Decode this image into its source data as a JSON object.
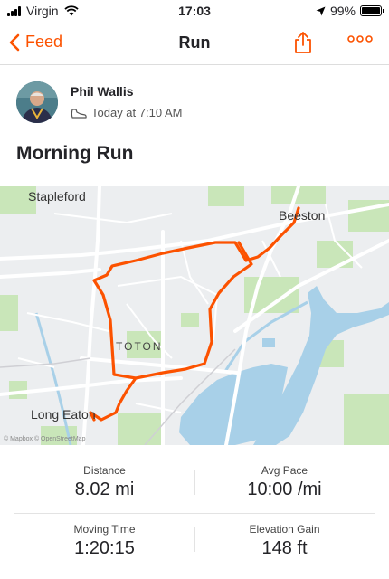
{
  "status": {
    "carrier": "Virgin",
    "time": "17:03",
    "battery": "99%",
    "battery_level": 0.99
  },
  "nav": {
    "back_label": "Feed",
    "title": "Run"
  },
  "athlete": {
    "name": "Phil Wallis",
    "timestamp": "Today at 7:10 AM"
  },
  "activity": {
    "title": "Morning Run"
  },
  "map": {
    "labels": {
      "stapleford": "Stapleford",
      "beeston": "Beeston",
      "toton": "TOTON",
      "long_eaton": "Long Eaton"
    },
    "attribution": "© Mapbox © OpenStreetMap"
  },
  "stats": {
    "distance_label": "Distance",
    "distance_value": "8.02 mi",
    "pace_label": "Avg Pace",
    "pace_value": "10:00 /mi",
    "moving_time_label": "Moving Time",
    "moving_time_value": "1:20:15",
    "elevation_label": "Elevation Gain",
    "elevation_value": "148 ft"
  },
  "colors": {
    "accent": "#fc5200",
    "route": "#fc5200",
    "water": "#a3cde6",
    "park": "#b7e0a8"
  }
}
